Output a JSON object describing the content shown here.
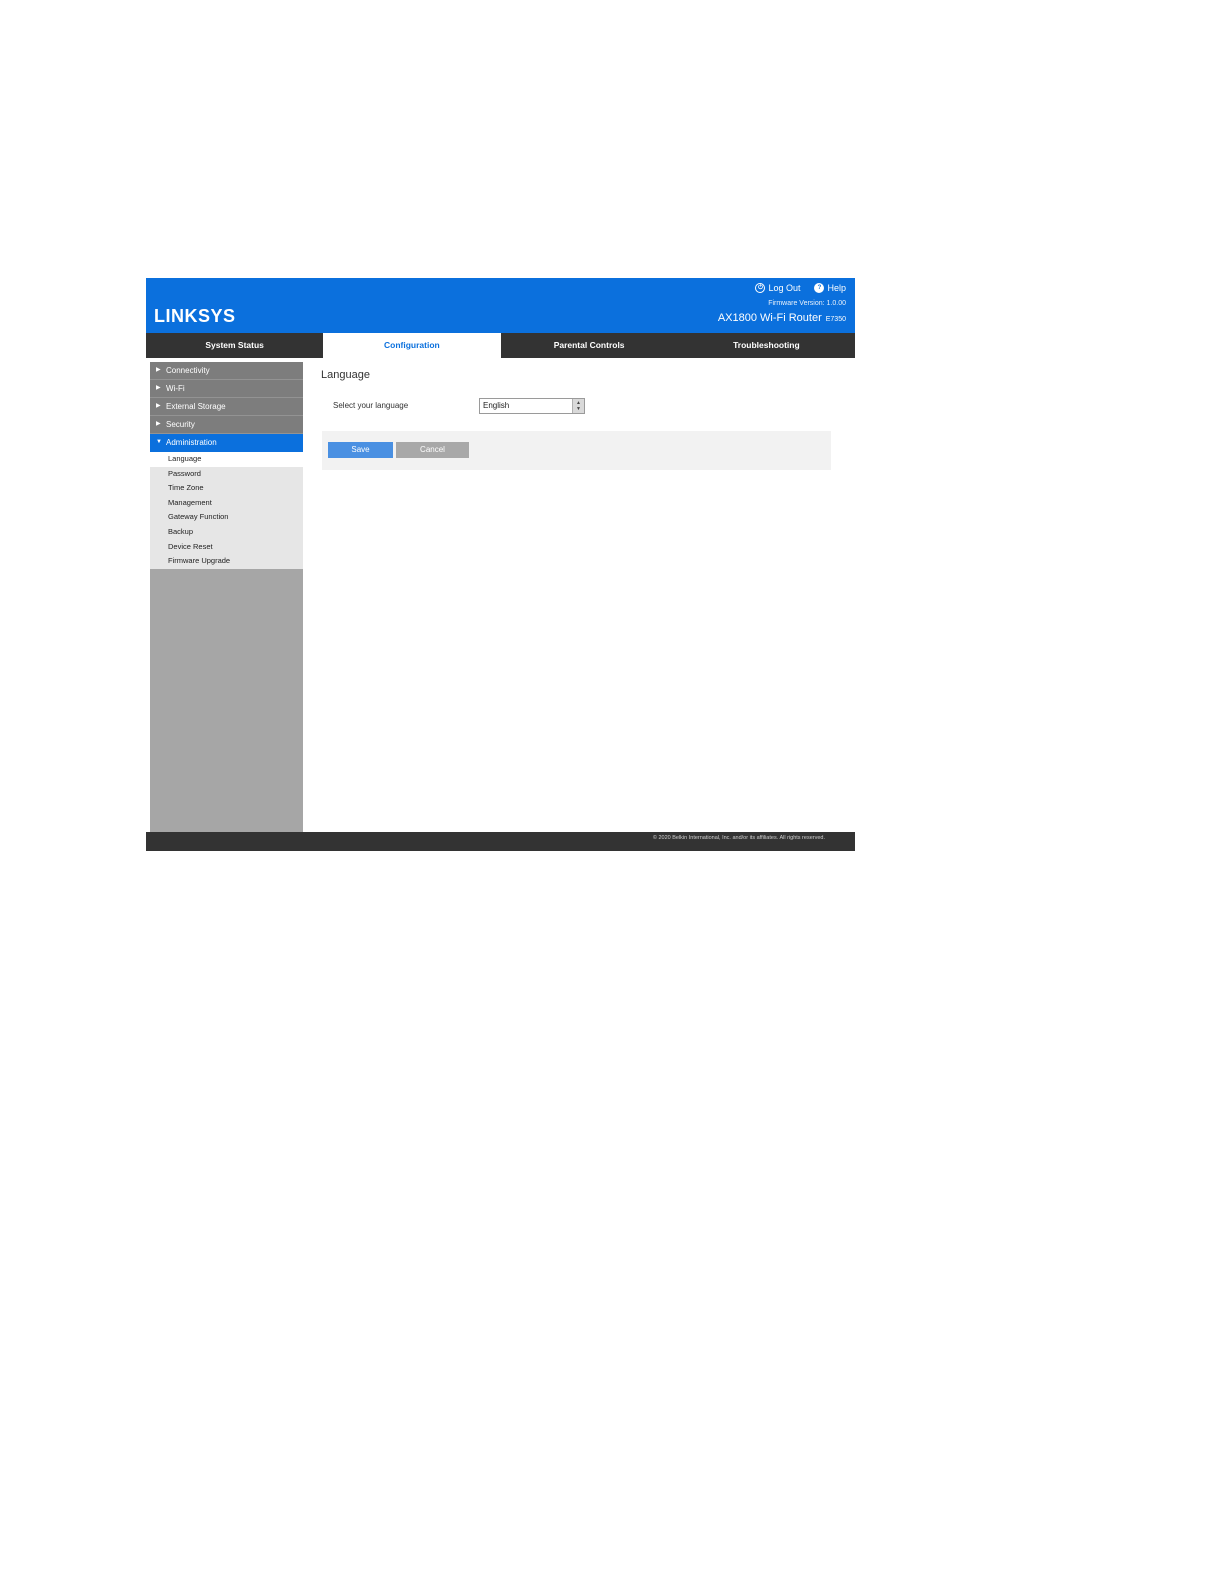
{
  "header": {
    "logo": "LINKSYS",
    "logout_label": "Log Out",
    "help_label": "Help",
    "firmware_version": "Firmware Version: 1.0.00",
    "router_name": "AX1800 Wi-Fi Router",
    "router_model": "E7350"
  },
  "tabs": [
    {
      "label": "System Status"
    },
    {
      "label": "Configuration"
    },
    {
      "label": "Parental Controls"
    },
    {
      "label": "Troubleshooting"
    }
  ],
  "sidebar": {
    "items": [
      {
        "label": "Connectivity"
      },
      {
        "label": "Wi-Fi"
      },
      {
        "label": "External Storage"
      },
      {
        "label": "Security"
      },
      {
        "label": "Administration"
      }
    ],
    "subitems": [
      {
        "label": "Language"
      },
      {
        "label": "Password"
      },
      {
        "label": "Time Zone"
      },
      {
        "label": "Management"
      },
      {
        "label": "Gateway Function"
      },
      {
        "label": "Backup"
      },
      {
        "label": "Device Reset"
      },
      {
        "label": "Firmware Upgrade"
      }
    ]
  },
  "main": {
    "title": "Language",
    "field_label": "Select your language",
    "language_value": "English",
    "save_label": "Save",
    "cancel_label": "Cancel"
  },
  "footer": {
    "copyright": "© 2020 Belkin International, Inc. and/or its affiliates. All rights reserved."
  },
  "colors": {
    "brand_blue": "#0b70dd",
    "tab_bar": "#333333",
    "sidebar_item": "#7d7d7d",
    "save_button": "#4a90e2",
    "cancel_button": "#a8a8a8"
  }
}
